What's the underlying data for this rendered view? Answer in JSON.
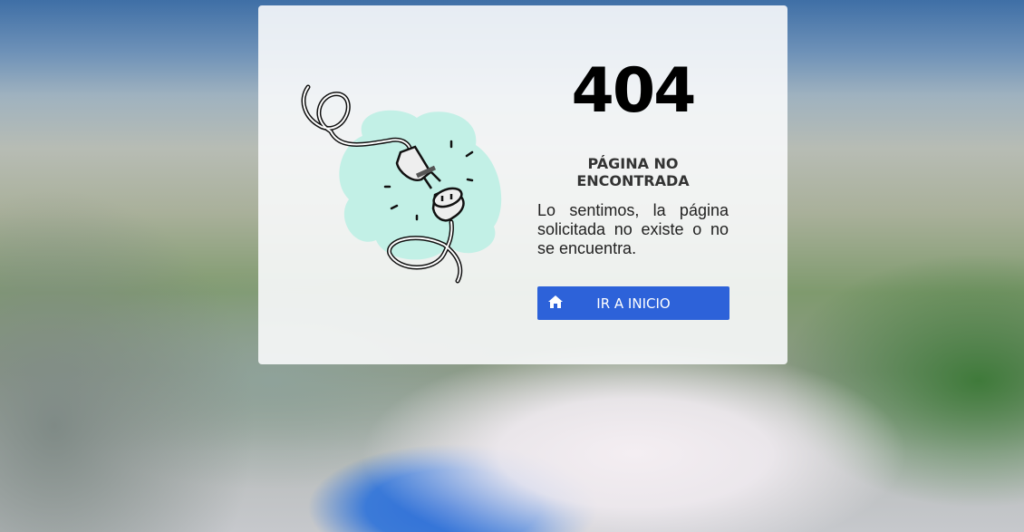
{
  "error": {
    "code": "404",
    "title": "PÁGINA NO ENCONTRADA",
    "message": "Lo sentimos, la página solicitada no existe o no se encuentra."
  },
  "button": {
    "label": "IR A INICIO",
    "icon": "home-icon",
    "color": "#2d62d9"
  },
  "illustration": {
    "name": "unplugged-cable",
    "accent": "#c2f0e6"
  }
}
